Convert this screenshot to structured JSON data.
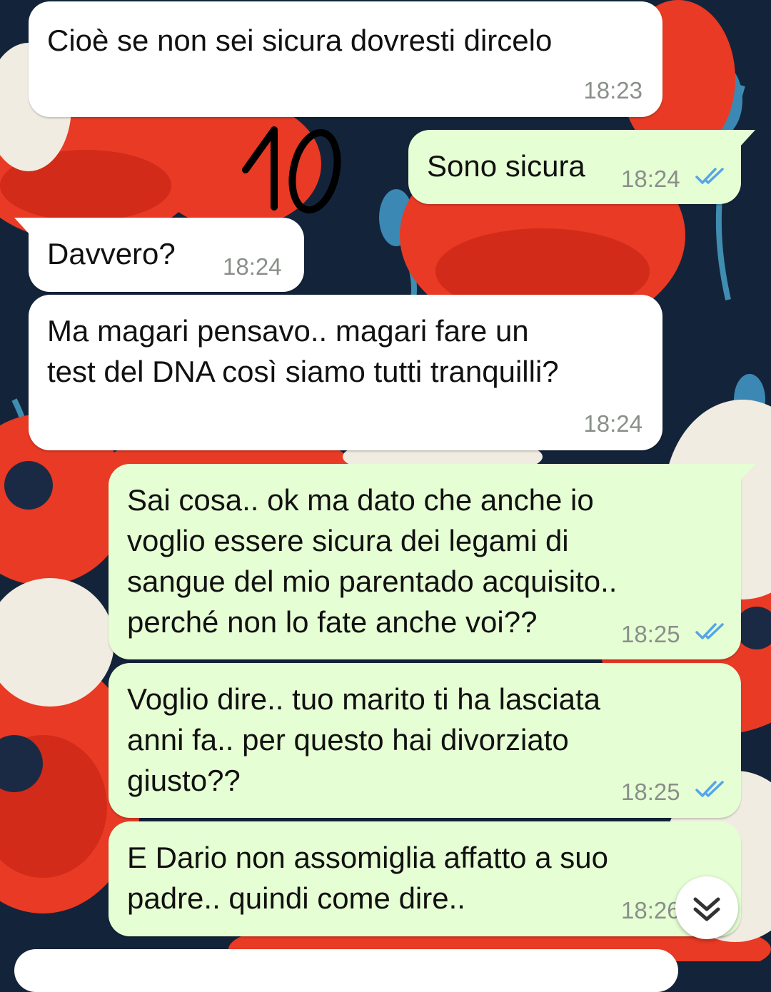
{
  "messages": [
    {
      "direction": "incoming",
      "text": "Cioè se non sei sicura dovresti dircelo",
      "time": "18:23",
      "status": ""
    },
    {
      "direction": "outgoing",
      "text": "Sono sicura",
      "time": "18:24",
      "status": "read"
    },
    {
      "direction": "incoming",
      "text": "Davvero?",
      "time": "18:24",
      "status": ""
    },
    {
      "direction": "incoming",
      "text": "Ma magari pensavo.. magari fare un\ntest del DNA così siamo tutti tranquilli?",
      "time": "18:24",
      "status": ""
    },
    {
      "direction": "outgoing",
      "text": "Sai cosa.. ok ma dato che anche io\nvoglio essere sicura dei legami di\nsangue del mio parentado acquisito..\nperché non lo fate anche voi??",
      "time": "18:25",
      "status": "read"
    },
    {
      "direction": "outgoing",
      "text": "Voglio dire.. tuo marito ti ha lasciata\nanni fa.. per questo hai divorziato\ngiusto??",
      "time": "18:25",
      "status": "read"
    },
    {
      "direction": "outgoing",
      "text": "E Dario non assomiglia affatto a suo\npadre.. quindi come dire..",
      "time": "18:26",
      "status": "read"
    }
  ],
  "annotation": {
    "text": "10"
  },
  "icons": {
    "scroll_down": "double-chevron-down-icon",
    "read_receipt": "double-check-icon"
  },
  "colors": {
    "incoming_bubble": "#ffffff",
    "outgoing_bubble": "#e6fed4",
    "read_tick": "#53a6e8",
    "timestamp": "#8a8f8a",
    "wallpaper_base": "#13243a",
    "poppy_red": "#e83a24"
  }
}
